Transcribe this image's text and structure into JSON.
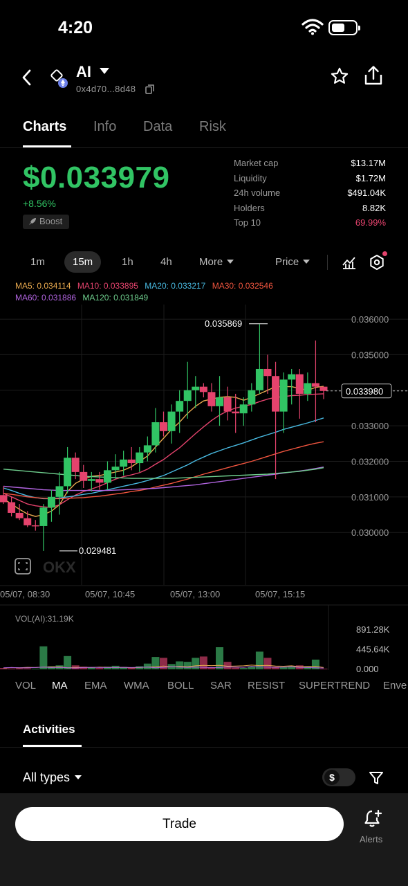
{
  "status_bar": {
    "time": "4:20"
  },
  "header": {
    "token_name": "AI",
    "address": "0x4d70...8d48"
  },
  "tabs": [
    {
      "label": "Charts",
      "active": true
    },
    {
      "label": "Info",
      "active": false
    },
    {
      "label": "Data",
      "active": false
    },
    {
      "label": "Risk",
      "active": false
    }
  ],
  "price": {
    "value": "$0.033979",
    "change": "+8.56%",
    "boost_label": "Boost"
  },
  "stats": [
    {
      "label": "Market cap",
      "value": "$13.17M"
    },
    {
      "label": "Liquidity",
      "value": "$1.72M"
    },
    {
      "label": "24h volume",
      "value": "$491.04K"
    },
    {
      "label": "Holders",
      "value": "8.82K"
    },
    {
      "label": "Top 10",
      "value": "69.99%"
    }
  ],
  "intervals": [
    "1m",
    "15m",
    "1h",
    "4h"
  ],
  "interval_active": "15m",
  "more_label": "More",
  "price_mode_label": "Price",
  "ma_legend": [
    {
      "label": "MA5: 0.034114",
      "color": "#e8a94e"
    },
    {
      "label": "MA10: 0.033895",
      "color": "#e5436d"
    },
    {
      "label": "MA20: 0.033217",
      "color": "#48b9e0"
    },
    {
      "label": "MA30: 0.032546",
      "color": "#f0553f"
    },
    {
      "label": "MA60: 0.031886",
      "color": "#b164e0"
    },
    {
      "label": "MA120: 0.031849",
      "color": "#6fcf8e"
    }
  ],
  "chart_data": {
    "type": "candlestick",
    "y_axis_ticks": [
      "0.036000",
      "0.035000",
      "0.034000",
      "0.033000",
      "0.032000",
      "0.031000",
      "0.030000"
    ],
    "ylim": [
      0.0294,
      0.0368
    ],
    "x_axis_ticks": [
      "05/07, 08:30",
      "05/07, 10:45",
      "05/07, 13:00",
      "05/07, 15:15"
    ],
    "current_price_label": "0.033980",
    "high_label": "0.035869",
    "low_label": "0.029481",
    "candles": [
      [
        0.03105,
        0.0313,
        0.0308,
        0.03085
      ],
      [
        0.03085,
        0.031,
        0.03045,
        0.03055
      ],
      [
        0.03055,
        0.0308,
        0.03035,
        0.0304
      ],
      [
        0.0304,
        0.0306,
        0.03015,
        0.0302
      ],
      [
        0.0302,
        0.03035,
        0.03005,
        0.03018
      ],
      [
        0.03018,
        0.0308,
        0.02948,
        0.0307
      ],
      [
        0.0307,
        0.0312,
        0.0303,
        0.031
      ],
      [
        0.031,
        0.0317,
        0.0305,
        0.0313
      ],
      [
        0.0313,
        0.0324,
        0.0311,
        0.0321
      ],
      [
        0.0321,
        0.03225,
        0.0315,
        0.0317
      ],
      [
        0.0317,
        0.0319,
        0.03125,
        0.03145
      ],
      [
        0.03145,
        0.0317,
        0.03115,
        0.0315
      ],
      [
        0.0315,
        0.0317,
        0.0312,
        0.0314
      ],
      [
        0.0314,
        0.032,
        0.0312,
        0.03175
      ],
      [
        0.03175,
        0.0322,
        0.0315,
        0.03185
      ],
      [
        0.03185,
        0.0323,
        0.0316,
        0.03205
      ],
      [
        0.03205,
        0.0324,
        0.03175,
        0.03195
      ],
      [
        0.03195,
        0.0324,
        0.0317,
        0.03225
      ],
      [
        0.03225,
        0.0327,
        0.032,
        0.03245
      ],
      [
        0.03245,
        0.0335,
        0.03225,
        0.0331
      ],
      [
        0.0331,
        0.0334,
        0.0327,
        0.03285
      ],
      [
        0.03285,
        0.0336,
        0.0325,
        0.0334
      ],
      [
        0.0334,
        0.034,
        0.0328,
        0.0337
      ],
      [
        0.0337,
        0.0348,
        0.0332,
        0.034
      ],
      [
        0.034,
        0.0344,
        0.0335,
        0.0341
      ],
      [
        0.0341,
        0.0342,
        0.0338,
        0.03395
      ],
      [
        0.03395,
        0.0342,
        0.0334,
        0.03355
      ],
      [
        0.03355,
        0.0344,
        0.033,
        0.0338
      ],
      [
        0.0338,
        0.0341,
        0.03315,
        0.0334
      ],
      [
        0.0334,
        0.0339,
        0.0328,
        0.03335
      ],
      [
        0.03335,
        0.0338,
        0.033,
        0.0336
      ],
      [
        0.0336,
        0.0342,
        0.0334,
        0.034
      ],
      [
        0.034,
        0.03586,
        0.0339,
        0.0346
      ],
      [
        0.0346,
        0.035,
        0.0339,
        0.0344
      ],
      [
        0.0344,
        0.0348,
        0.0315,
        0.0334
      ],
      [
        0.0334,
        0.0345,
        0.0328,
        0.0343
      ],
      [
        0.0343,
        0.0346,
        0.0336,
        0.03445
      ],
      [
        0.03445,
        0.0346,
        0.0332,
        0.0339
      ],
      [
        0.0339,
        0.0345,
        0.0337,
        0.0342
      ],
      [
        0.0342,
        0.0354,
        0.0331,
        0.0341
      ],
      [
        0.0341,
        0.0341,
        0.03375,
        0.03398
      ]
    ],
    "ma_series": [
      {
        "name": "MA5",
        "color": "#e8a94e",
        "values": [
          0.03095,
          0.0308,
          0.03065,
          0.03052,
          0.03045,
          0.0305,
          0.0306,
          0.03078,
          0.03115,
          0.03138,
          0.0315,
          0.03158,
          0.0316,
          0.03165,
          0.0317,
          0.03175,
          0.03185,
          0.032,
          0.03215,
          0.0324,
          0.03265,
          0.0329,
          0.0331,
          0.03335,
          0.03355,
          0.0337,
          0.03375,
          0.0338,
          0.03382,
          0.0338,
          0.03372,
          0.0338,
          0.0339,
          0.034,
          0.0341,
          0.0341,
          0.0341,
          0.03405,
          0.034,
          0.03408,
          0.03411
        ]
      },
      {
        "name": "MA10",
        "color": "#e5436d",
        "values": [
          0.0311,
          0.031,
          0.0309,
          0.0308,
          0.03075,
          0.03072,
          0.0307,
          0.03078,
          0.03092,
          0.03105,
          0.03115,
          0.03122,
          0.0313,
          0.0314,
          0.0315,
          0.03157,
          0.03162,
          0.03168,
          0.03178,
          0.03192,
          0.03205,
          0.03222,
          0.03238,
          0.03258,
          0.03278,
          0.03297,
          0.03315,
          0.0333,
          0.03342,
          0.0335,
          0.03355,
          0.0336,
          0.03368,
          0.03375,
          0.0338,
          0.03382,
          0.03385,
          0.03386,
          0.03388,
          0.03389,
          0.0339
        ]
      },
      {
        "name": "MA20",
        "color": "#48b9e0",
        "values": [
          0.03125,
          0.03118,
          0.0311,
          0.03103,
          0.03098,
          0.03095,
          0.03095,
          0.03097,
          0.031,
          0.03103,
          0.03107,
          0.0311,
          0.03115,
          0.0312,
          0.03125,
          0.0313,
          0.03135,
          0.0314,
          0.03146,
          0.03153,
          0.0316,
          0.0317,
          0.0318,
          0.0319,
          0.03202,
          0.03212,
          0.03222,
          0.0323,
          0.03238,
          0.03245,
          0.03252,
          0.0326,
          0.03268,
          0.03275,
          0.03282,
          0.0329,
          0.03296,
          0.03302,
          0.03308,
          0.03315,
          0.03322
        ]
      },
      {
        "name": "MA30",
        "color": "#f0553f",
        "values": [
          0.0311,
          0.03107,
          0.03104,
          0.031,
          0.03098,
          0.03096,
          0.03095,
          0.03095,
          0.03096,
          0.03097,
          0.03098,
          0.031,
          0.03102,
          0.03105,
          0.03108,
          0.03111,
          0.03115,
          0.03118,
          0.03122,
          0.03128,
          0.03133,
          0.03138,
          0.03144,
          0.0315,
          0.03157,
          0.03164,
          0.0317,
          0.03176,
          0.03182,
          0.03188,
          0.03194,
          0.032,
          0.03207,
          0.03214,
          0.03221,
          0.03228,
          0.03234,
          0.0324,
          0.03246,
          0.03251,
          0.03255
        ]
      },
      {
        "name": "MA60",
        "color": "#b164e0",
        "values": [
          0.0313,
          0.03128,
          0.03126,
          0.03124,
          0.03122,
          0.0312,
          0.03119,
          0.03118,
          0.03118,
          0.03118,
          0.03118,
          0.03118,
          0.03118,
          0.03118,
          0.03119,
          0.0312,
          0.03121,
          0.03122,
          0.03123,
          0.03124,
          0.03126,
          0.03128,
          0.0313,
          0.03132,
          0.03134,
          0.03137,
          0.0314,
          0.03143,
          0.03146,
          0.03149,
          0.03152,
          0.03155,
          0.03158,
          0.03161,
          0.03164,
          0.03167,
          0.0317,
          0.03173,
          0.03176,
          0.0318,
          0.03184
        ]
      },
      {
        "name": "MA120",
        "color": "#6fcf8e",
        "values": [
          0.03178,
          0.03176,
          0.03174,
          0.03172,
          0.0317,
          0.03168,
          0.03166,
          0.03164,
          0.03162,
          0.0316,
          0.03158,
          0.03157,
          0.03156,
          0.03155,
          0.03154,
          0.03153,
          0.03152,
          0.03152,
          0.03152,
          0.03152,
          0.03152,
          0.03152,
          0.03153,
          0.03154,
          0.03155,
          0.03156,
          0.03157,
          0.03158,
          0.03159,
          0.0316,
          0.03161,
          0.03162,
          0.03163,
          0.03164,
          0.03166,
          0.03168,
          0.0317,
          0.03172,
          0.03175,
          0.03178,
          0.03182
        ]
      }
    ],
    "volume": {
      "label": "VOL(AI):31.19K",
      "ticks": [
        "891.28K",
        "445.64K",
        "0.000"
      ],
      "ymax": 891.28,
      "values": [
        30,
        40,
        35,
        45,
        40,
        50,
        55,
        60,
        35,
        40,
        45,
        40,
        50,
        45,
        40,
        45,
        35,
        40,
        50,
        60,
        75,
        55,
        65,
        60,
        80,
        90,
        85,
        90,
        70,
        75,
        80,
        95,
        85,
        90,
        75,
        70,
        80,
        60,
        65,
        70,
        40
      ],
      "overlay_values": [
        35,
        40,
        35,
        35,
        40,
        50,
        40,
        45,
        35,
        30,
        40,
        45,
        40,
        40,
        40,
        45,
        40,
        45,
        50,
        35,
        45,
        60,
        50,
        45,
        50,
        45,
        40,
        40,
        55,
        50,
        45,
        65,
        55,
        50,
        45,
        50,
        60,
        45,
        40,
        35,
        30
      ],
      "bars": [
        {
          "value": 30,
          "up": false
        },
        {
          "value": 20,
          "up": false
        },
        {
          "value": 25,
          "up": false
        },
        {
          "value": 22,
          "up": false
        },
        {
          "value": 15,
          "up": true
        },
        {
          "value": 520,
          "up": true
        },
        {
          "value": 70,
          "up": true
        },
        {
          "value": 90,
          "up": true
        },
        {
          "value": 300,
          "up": true
        },
        {
          "value": 90,
          "up": false
        },
        {
          "value": 60,
          "up": false
        },
        {
          "value": 40,
          "up": true
        },
        {
          "value": 30,
          "up": false
        },
        {
          "value": 60,
          "up": true
        },
        {
          "value": 80,
          "up": true
        },
        {
          "value": 55,
          "up": true
        },
        {
          "value": 40,
          "up": false
        },
        {
          "value": 70,
          "up": true
        },
        {
          "value": 130,
          "up": true
        },
        {
          "value": 280,
          "up": true
        },
        {
          "value": 260,
          "up": false
        },
        {
          "value": 120,
          "up": true
        },
        {
          "value": 180,
          "up": true
        },
        {
          "value": 170,
          "up": true
        },
        {
          "value": 260,
          "up": true
        },
        {
          "value": 290,
          "up": false
        },
        {
          "value": 50,
          "up": false
        },
        {
          "value": 500,
          "up": true
        },
        {
          "value": 170,
          "up": false
        },
        {
          "value": 40,
          "up": false
        },
        {
          "value": 30,
          "up": true
        },
        {
          "value": 60,
          "up": true
        },
        {
          "value": 400,
          "up": true
        },
        {
          "value": 260,
          "up": false
        },
        {
          "value": 60,
          "up": false
        },
        {
          "value": 50,
          "up": true
        },
        {
          "value": 70,
          "up": true
        },
        {
          "value": 90,
          "up": false
        },
        {
          "value": 60,
          "up": true
        },
        {
          "value": 220,
          "up": true
        },
        {
          "value": 15,
          "up": false
        }
      ]
    }
  },
  "indicator_tabs": [
    "VOL",
    "MA",
    "EMA",
    "WMA",
    "BOLL",
    "SAR",
    "RESIST",
    "SUPERTREND",
    "Enve"
  ],
  "indicator_active": "MA",
  "activities": {
    "title": "Activities",
    "filter_label": "All types",
    "currency_symbol": "$"
  },
  "bottom_bar": {
    "trade_label": "Trade",
    "alerts_label": "Alerts"
  },
  "colors": {
    "up": "#31c464",
    "down": "#e5436d",
    "background": "#000000"
  },
  "icons": [
    "back-arrow-icon",
    "token-logo-icon",
    "ethereum-badge-icon",
    "copy-icon",
    "star-icon",
    "share-icon",
    "indicator-chart-icon",
    "settings-hexagon-icon",
    "fullscreen-icon",
    "filter-icon",
    "bell-plus-icon",
    "rocket-icon",
    "wifi-icon",
    "battery-icon"
  ]
}
